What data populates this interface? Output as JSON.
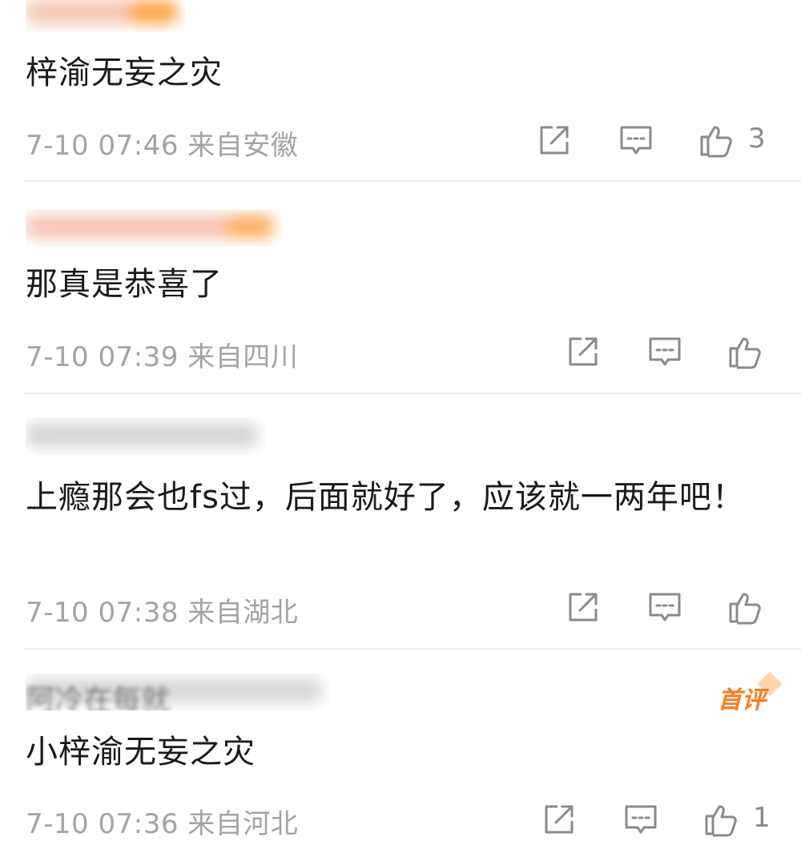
{
  "comments": [
    {
      "text": "梓渝无妄之灾",
      "time": "7-10 07:46",
      "location": "来自安徽",
      "likes": "3"
    },
    {
      "text": "那真是恭喜了",
      "time": "7-10 07:39",
      "location": "来自四川",
      "likes": ""
    },
    {
      "text": "上瘾那会也fs过，后面就好了，应该就一两年吧！",
      "time": "7-10 07:38",
      "location": "来自湖北",
      "likes": ""
    },
    {
      "username": "阿冷在每就",
      "text": "小梓渝无妄之灾",
      "time": "7-10 07:36",
      "location": "来自河北",
      "likes": "1",
      "badge": "首评"
    }
  ],
  "icons": {
    "share": "share-icon",
    "reply": "comment-icon",
    "like": "thumbs-up-icon"
  },
  "colors": {
    "text": "#1a1a1a",
    "meta": "#a3a3a3",
    "icon": "#8a8a8a",
    "badge": "#ff7a1a"
  }
}
